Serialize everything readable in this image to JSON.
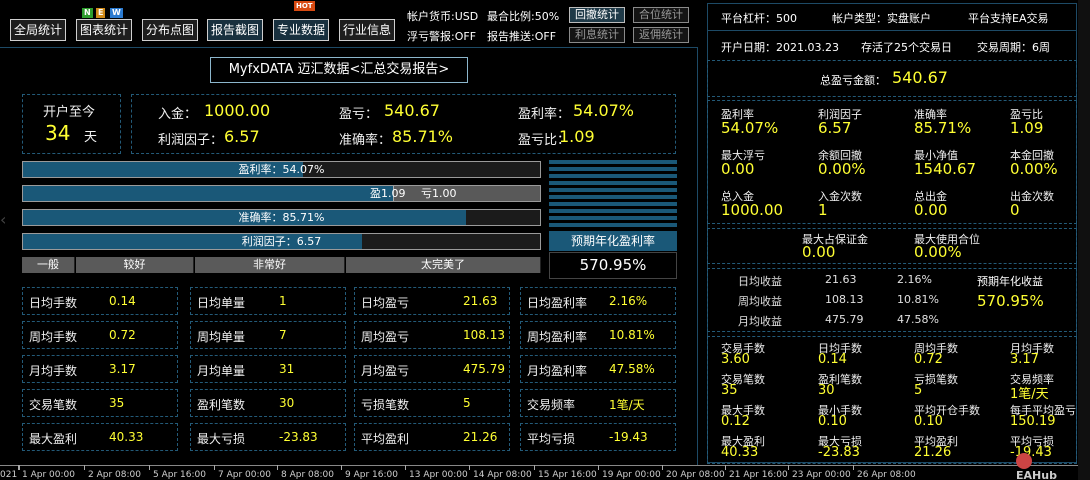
{
  "toolbar": {
    "buttons": [
      "全局统计",
      "图表统计",
      "分布点图",
      "报告截图",
      "专业数据",
      "行业信息"
    ],
    "new_badge": [
      "N",
      "E",
      "W"
    ],
    "hot_badge": "HOT",
    "info": [
      "帐户货币:USD",
      "最合比例:50%",
      "浮亏警报:OFF",
      "报告推送:OFF"
    ],
    "small_buttons": [
      "回撤统计",
      "合位统计",
      "利息统计",
      "返佣统计"
    ]
  },
  "report_title": "MyfxDATA 迈汇数据<汇总交易报告>",
  "summary": {
    "days_label": "开户至今",
    "days_value": "34",
    "days_unit": "天",
    "deposit_label": "入金：",
    "deposit_value": "1000.00",
    "pl_label": "盈亏：",
    "pl_value": "540.67",
    "profit_rate_label": "盈利率：",
    "profit_rate_value": "54.07%",
    "profit_factor_label": "利润因子：",
    "profit_factor_value": "6.57",
    "accuracy_label": "准确率：",
    "accuracy_value": "85.71%",
    "pl_ratio_label": "盈亏比：",
    "pl_ratio_value": "1.09"
  },
  "bars": {
    "profit_rate": {
      "text": "盈利率：54.07%",
      "fraction": 0.541
    },
    "win_loss": {
      "win_text": "盈1.09",
      "loss_text": "亏1.00",
      "fraction": 0.715
    },
    "accuracy": {
      "text": "准确率：85.71%",
      "fraction": 0.857
    },
    "profit_factor": {
      "text": "利润因子：6.57",
      "fraction": 0.656
    }
  },
  "scale_labels": [
    "一般",
    "较好",
    "非常好",
    "太完美了"
  ],
  "annual": {
    "label": "预期年化盈利率",
    "value": "570.95%"
  },
  "grid": [
    [
      "日均手数",
      "0.14",
      "日均单量",
      "1",
      "日均盈亏",
      "21.63",
      "日均盈利率",
      "2.16%"
    ],
    [
      "周均手数",
      "0.72",
      "周均单量",
      "7",
      "周均盈亏",
      "108.13",
      "周均盈利率",
      "10.81%"
    ],
    [
      "月均手数",
      "3.17",
      "月均单量",
      "31",
      "月均盈亏",
      "475.79",
      "月均盈利率",
      "47.58%"
    ],
    [
      "交易笔数",
      "35",
      "盈利笔数",
      "30",
      "亏损笔数",
      "5",
      "交易频率",
      "1笔/天"
    ],
    [
      "最大盈利",
      "40.33",
      "最大亏损",
      "-23.83",
      "平均盈利",
      "21.26",
      "平均亏损",
      "-19.43"
    ]
  ],
  "right": {
    "header": [
      "平台杠杆：500",
      "帐户类型：实盘账户",
      "平台支持EA交易"
    ],
    "header2": [
      "开户日期：2021.03.23",
      "存活了25个交易日",
      "交易周期：6周"
    ],
    "total_label": "总盈亏金额：",
    "total_value": "540.67",
    "stats1": [
      [
        "盈利率",
        "54.07%"
      ],
      [
        "利润因子",
        "6.57"
      ],
      [
        "准确率",
        "85.71%"
      ],
      [
        "盈亏比",
        "1.09"
      ],
      [
        "最大浮亏",
        "0.00"
      ],
      [
        "余额回撤",
        "0.00%"
      ],
      [
        "最小净值",
        "1540.67"
      ],
      [
        "本金回撤",
        "0.00%"
      ],
      [
        "总入金",
        "1000.00"
      ],
      [
        "入金次数",
        "1"
      ],
      [
        "总出金",
        "0.00"
      ],
      [
        "出金次数",
        "0"
      ]
    ],
    "margin": [
      [
        "最大占保证金",
        "0.00"
      ],
      [
        "最大使用合位",
        "0.00%"
      ]
    ],
    "yield_rows": [
      [
        "日均收益",
        "21.63",
        "2.16%"
      ],
      [
        "周均收益",
        "108.13",
        "10.81%"
      ],
      [
        "月均收益",
        "475.79",
        "47.58%"
      ]
    ],
    "annual_label": "预期年化收益",
    "annual_value": "570.95%",
    "stats2": [
      [
        "交易手数",
        "3.60"
      ],
      [
        "日均手数",
        "0.14"
      ],
      [
        "周均手数",
        "0.72"
      ],
      [
        "月均手数",
        "3.17"
      ],
      [
        "交易笔数",
        "35"
      ],
      [
        "盈利笔数",
        "30"
      ],
      [
        "亏损笔数",
        "5"
      ],
      [
        "交易频率",
        "1笔/天"
      ],
      [
        "最大手数",
        "0.12"
      ],
      [
        "最小手数",
        "0.10"
      ],
      [
        "平均开仓手数",
        "0.10"
      ],
      [
        "每手平均盈亏",
        "150.19"
      ],
      [
        "最大盈利",
        "40.33"
      ],
      [
        "最大亏损",
        "-23.83"
      ],
      [
        "平均盈利",
        "21.26"
      ],
      [
        "平均亏损",
        "-19.43"
      ]
    ]
  },
  "axis_labels": [
    "021",
    "1 Apr 00:00",
    "2 Apr 08:00",
    "5 Apr 16:00",
    "7 Apr 00:00",
    "8 Apr 08:00",
    "9 Apr 16:00",
    "13 Apr 00:00",
    "14 Apr 08:00",
    "15 Apr 16:00",
    "19 Apr 00:00",
    "20 Apr 08:00",
    "21 Apr 16:00",
    "23 Apr 00:00",
    "26 Apr 08:00"
  ],
  "watermark": "EAHub"
}
